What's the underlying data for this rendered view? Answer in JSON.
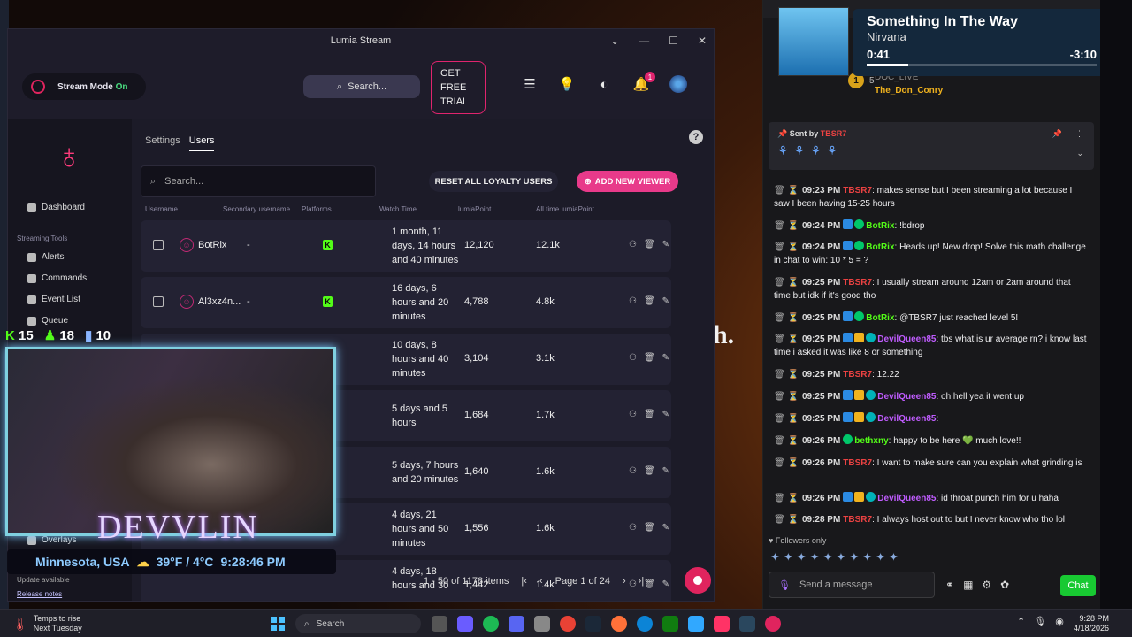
{
  "lumia": {
    "window_title": "Lumia Stream",
    "stream_mode_label": "Stream Mode",
    "stream_mode_state": "On",
    "search_label": "Search...",
    "trial_label": "GET FREE TRIAL",
    "notification_count": "1",
    "sidebar": {
      "dashboard": "Dashboard",
      "section_heading": "Streaming Tools",
      "items": [
        "Alerts",
        "Commands",
        "Event List",
        "Queue"
      ],
      "overlays": "Overlays",
      "update": "Update available",
      "release_notes": "Release notes"
    },
    "tabs": [
      "Settings",
      "Users"
    ],
    "active_tab": "Users",
    "users_search_placeholder": "Search...",
    "reset_button": "RESET ALL LOYALTY USERS",
    "add_button": "ADD NEW VIEWER",
    "columns": [
      "Username",
      "Secondary username",
      "Platforms",
      "Watch Time",
      "lumiaPoint",
      "All time lumiaPoint"
    ],
    "rows": [
      {
        "username": "BotRix",
        "secondary": "-",
        "watch_time": "1 month, 11 days, 14 hours and 40 minutes",
        "points": "12,120",
        "all_time": "12.1k"
      },
      {
        "username": "Al3xz4n...",
        "secondary": "-",
        "watch_time": "16 days, 6 hours and 20 minutes",
        "points": "4,788",
        "all_time": "4.8k"
      },
      {
        "username": "",
        "secondary": "",
        "watch_time": "10 days, 8 hours and 40 minutes",
        "points": "3,104",
        "all_time": "3.1k"
      },
      {
        "username": "",
        "secondary": "",
        "watch_time": "5 days and 5 hours",
        "points": "1,684",
        "all_time": "1.7k"
      },
      {
        "username": "",
        "secondary": "",
        "watch_time": "5 days, 7 hours and 20 minutes",
        "points": "1,640",
        "all_time": "1.6k"
      },
      {
        "username": "",
        "secondary": "",
        "watch_time": "4 days, 21 hours and 50 minutes",
        "points": "1,556",
        "all_time": "1.6k"
      },
      {
        "username": "",
        "secondary": "",
        "watch_time": "4 days, 18 hours and 30",
        "points": "1,442",
        "all_time": "1.4k"
      }
    ],
    "pagination": {
      "range": "1 - 50 of 1178 items",
      "page": "Page 1 of 24"
    }
  },
  "overlay": {
    "kick_count": "15",
    "followers_count": "18",
    "viewers_count": "10",
    "streamer_name": "DEVVLIN",
    "location_line": "Minnesota, USA",
    "weather_line": "39°F / 4°C",
    "clock_line": "9:28:46 PM"
  },
  "now_playing": {
    "title": "Something In The Way",
    "artist": "Nirvana",
    "elapsed": "0:41",
    "remaining": "-3:10",
    "progress_fraction": 0.18
  },
  "chat": {
    "top_rank": "1",
    "top_names": [
      "DOC_LIVE",
      "The_Don_Conry"
    ],
    "top_score": "5",
    "pinned": {
      "label": "Sent by",
      "user": "TBSR7"
    },
    "messages": [
      {
        "time": "09:23 PM",
        "user": "TBSR7",
        "color": "#eb4242",
        "badges": [],
        "text": "makes sense but I been streaming a lot because I saw I been having 15-25 hours"
      },
      {
        "time": "09:24 PM",
        "user": "BotRix",
        "color": "#53fc18",
        "badges": [
          "blue",
          "green"
        ],
        "text": "!bdrop"
      },
      {
        "time": "09:24 PM",
        "user": "BotRix",
        "color": "#53fc18",
        "badges": [
          "blue",
          "green"
        ],
        "text": "Heads up! New drop! Solve this math challenge in chat to win: 10 * 5 = ?"
      },
      {
        "time": "09:25 PM",
        "user": "TBSR7",
        "color": "#eb4242",
        "badges": [],
        "text": "I usually stream around 12am or 2am around that time but idk if it's good tho"
      },
      {
        "time": "09:25 PM",
        "user": "BotRix",
        "color": "#53fc18",
        "badges": [
          "blue",
          "green"
        ],
        "text": "@TBSR7 just reached level 5!"
      },
      {
        "time": "09:25 PM",
        "user": "DevilQueen85",
        "color": "#c05cff",
        "badges": [
          "blue",
          "gold",
          "teal"
        ],
        "text": "tbs what is ur average rn? i know last time i asked it was like 8 or something"
      },
      {
        "time": "09:25 PM",
        "user": "TBSR7",
        "color": "#eb4242",
        "badges": [],
        "text": "12.22"
      },
      {
        "time": "09:25 PM",
        "user": "DevilQueen85",
        "color": "#c05cff",
        "badges": [
          "blue",
          "gold",
          "teal"
        ],
        "text": "oh hell yea it went up"
      },
      {
        "time": "09:25 PM",
        "user": "DevilQueen85",
        "color": "#c05cff",
        "badges": [
          "blue",
          "gold",
          "teal"
        ],
        "text": ""
      },
      {
        "time": "09:26 PM",
        "user": "bethxny",
        "color": "#53fc18",
        "badges": [
          "green"
        ],
        "text": "happy to be here 💚 much love!!"
      },
      {
        "time": "09:26 PM",
        "user": "TBSR7",
        "color": "#eb4242",
        "badges": [],
        "text": "I want to make sure can you explain what grinding is"
      },
      {
        "time": "09:26 PM",
        "user": "DevilQueen85",
        "color": "#c05cff",
        "badges": [
          "blue",
          "gold",
          "teal"
        ],
        "text": "id throat punch him for u haha"
      },
      {
        "time": "09:28 PM",
        "user": "TBSR7",
        "color": "#eb4242",
        "badges": [],
        "text": "I always host out to but I never know who tho lol"
      }
    ],
    "followers_only": "Followers only",
    "input_placeholder": "Send a message",
    "send_label": "Chat"
  },
  "taskbar": {
    "weather_title": "Temps to rise",
    "weather_sub": "Next Tuesday",
    "search_label": "Search",
    "time": "9:28 PM",
    "date": "4/18/2026"
  },
  "background": {
    "visible_letter": "h."
  }
}
